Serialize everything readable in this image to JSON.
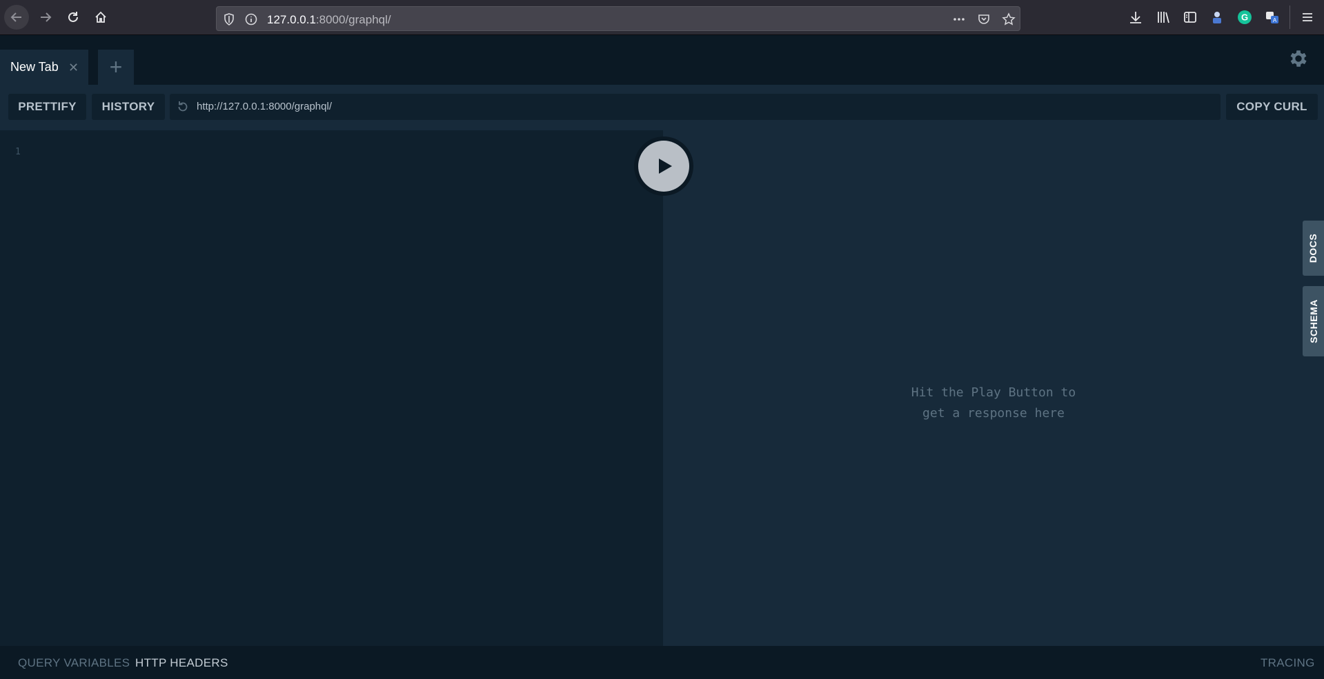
{
  "browser": {
    "url_host": "127.0.0.1",
    "url_rest": ":8000/graphql/"
  },
  "tabs": [
    {
      "label": "New Tab",
      "close_glyph": "✕"
    }
  ],
  "add_tab_glyph": "+",
  "toolbar": {
    "prettify_label": "PRETTIFY",
    "history_label": "HISTORY",
    "endpoint_url": "http://127.0.0.1:8000/graphql/",
    "copy_curl_label": "COPY CURL"
  },
  "editor": {
    "line_numbers": [
      "1"
    ]
  },
  "result": {
    "placeholder_line1": "Hit the Play Button to",
    "placeholder_line2": "get a response here"
  },
  "side_tabs": {
    "docs_label": "DOCS",
    "schema_label": "SCHEMA"
  },
  "bottom": {
    "query_variables_label": "QUERY VARIABLES",
    "http_headers_label": "HTTP HEADERS",
    "tracing_label": "TRACING"
  },
  "colors": {
    "editor_bg": "#0f202d",
    "result_bg": "#172a3a",
    "tab_strip_bg": "#0b1924",
    "side_tab_bg": "#3d5363",
    "play_button": "#b9bfc6"
  }
}
